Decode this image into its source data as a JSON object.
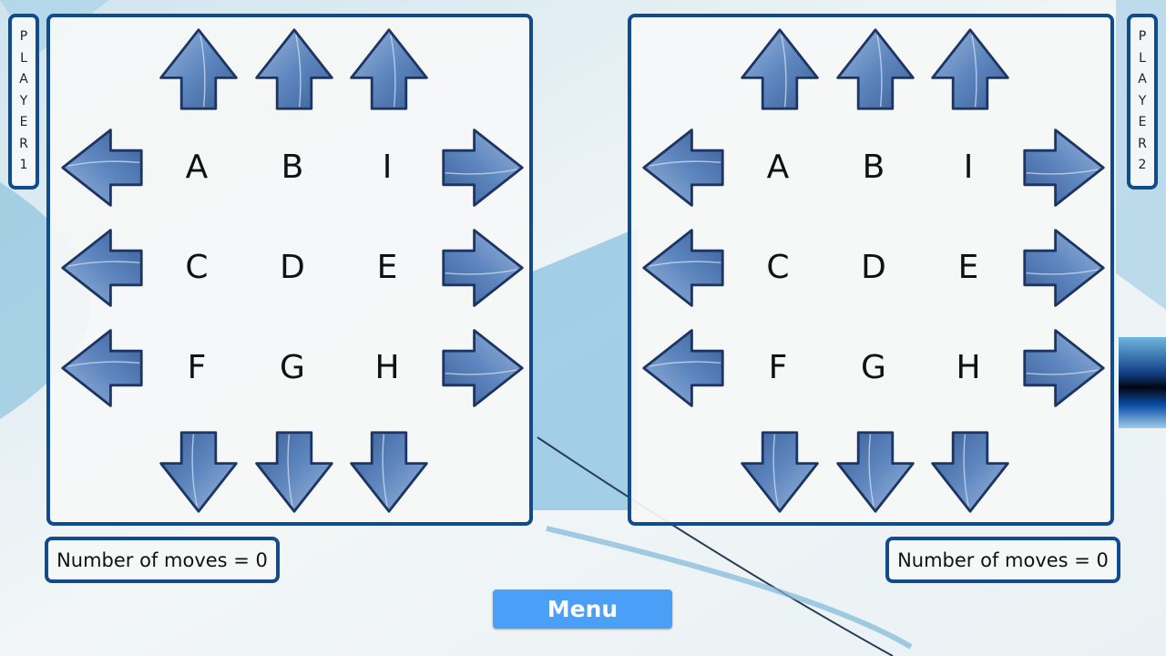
{
  "players": [
    {
      "tag_letters": [
        "P",
        "L",
        "A",
        "Y",
        "E",
        "R",
        "1"
      ],
      "grid": [
        [
          "A",
          "B",
          "I"
        ],
        [
          "C",
          "D",
          "E"
        ],
        [
          "F",
          "G",
          "H"
        ]
      ],
      "moves_label": "Number of moves = 0",
      "moves": 0
    },
    {
      "tag_letters": [
        "P",
        "L",
        "A",
        "Y",
        "E",
        "R",
        "2"
      ],
      "grid": [
        [
          "A",
          "B",
          "I"
        ],
        [
          "C",
          "D",
          "E"
        ],
        [
          "F",
          "G",
          "H"
        ]
      ],
      "moves_label": "Number of moves = 0",
      "moves": 0
    }
  ],
  "arrows": {
    "up": "arrow-up-icon",
    "down": "arrow-down-icon",
    "left": "arrow-left-icon",
    "right": "arrow-right-icon"
  },
  "menu": {
    "label": "Menu"
  },
  "colors": {
    "border": "#114a8d",
    "arrow_fill": "#5f87bf",
    "menu_button": "#4aa0f6"
  }
}
